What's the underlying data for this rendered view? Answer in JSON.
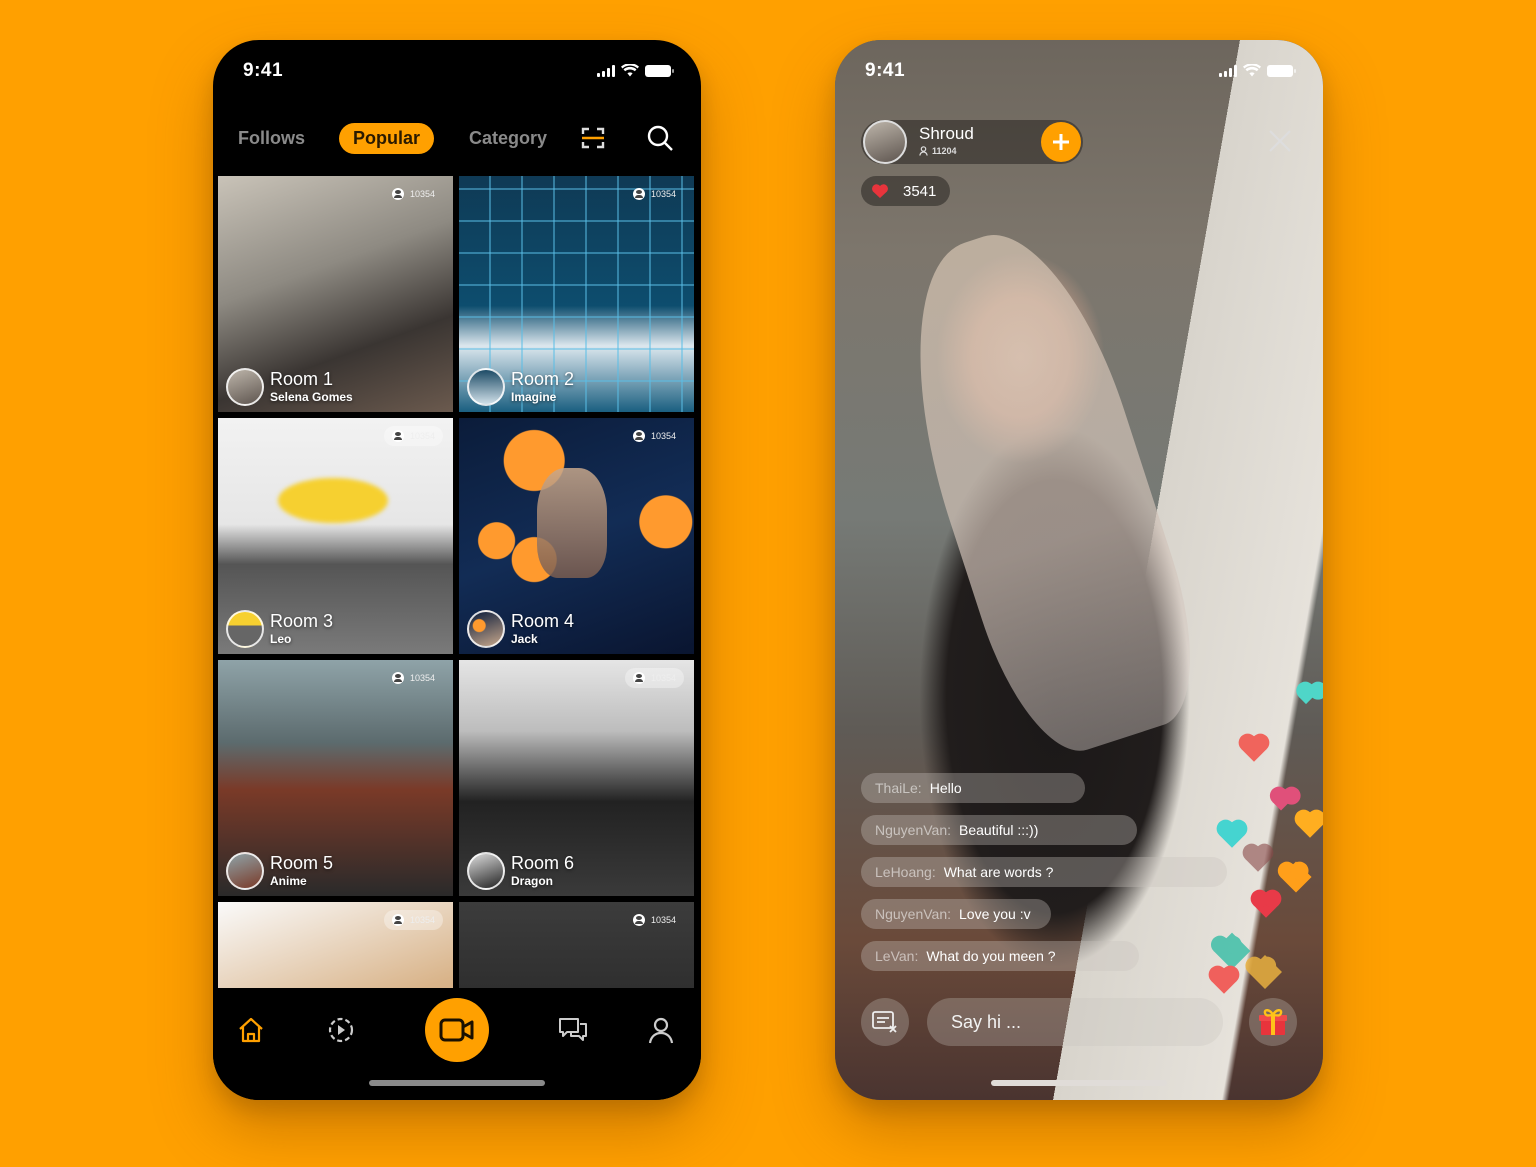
{
  "colors": {
    "background": "#FFA000",
    "accent": "#FFA000",
    "phone_left_bg": "#000000"
  },
  "left_phone": {
    "status_bar": {
      "time": "9:41",
      "icons": [
        "signal-icon",
        "wifi-icon",
        "battery-icon"
      ]
    },
    "top_nav": {
      "tabs": [
        {
          "label": "Follows",
          "active": false
        },
        {
          "label": "Popular",
          "active": true
        },
        {
          "label": "Category",
          "active": false
        }
      ],
      "icons": [
        "scan-icon",
        "search-icon"
      ]
    },
    "rooms": [
      {
        "room": "Room 1",
        "host": "Selena Gomes",
        "viewers": "10354"
      },
      {
        "room": "Room 2",
        "host": "Imagine",
        "viewers": "10354"
      },
      {
        "room": "Room 3",
        "host": "Leo",
        "viewers": "10354"
      },
      {
        "room": "Room 4",
        "host": "Jack",
        "viewers": "10354"
      },
      {
        "room": "Room 5",
        "host": "Anime",
        "viewers": "10354"
      },
      {
        "room": "Room 6",
        "host": "Dragon",
        "viewers": "10354"
      },
      {
        "room": "",
        "host": "",
        "viewers": "10354"
      },
      {
        "room": "",
        "host": "",
        "viewers": "10354"
      }
    ],
    "bottom_nav": [
      "home-icon",
      "playback-icon",
      "go-live-camera-icon",
      "messages-icon",
      "profile-icon"
    ]
  },
  "right_phone": {
    "status_bar": {
      "time": "9:41"
    },
    "host": {
      "name": "Shroud",
      "followers": "11204"
    },
    "likes": "3541",
    "chat": [
      {
        "user": "ThaiLe:",
        "text": "Hello"
      },
      {
        "user": "NguyenVan:",
        "text": "Beautiful :::))"
      },
      {
        "user": "LeHoang:",
        "text": "What are words ?"
      },
      {
        "user": "NguyenVan:",
        "text": "Love you :v"
      },
      {
        "user": "LeVan:",
        "text": "What do you meen ?"
      }
    ],
    "composer": {
      "placeholder": "Say hi ..."
    }
  }
}
